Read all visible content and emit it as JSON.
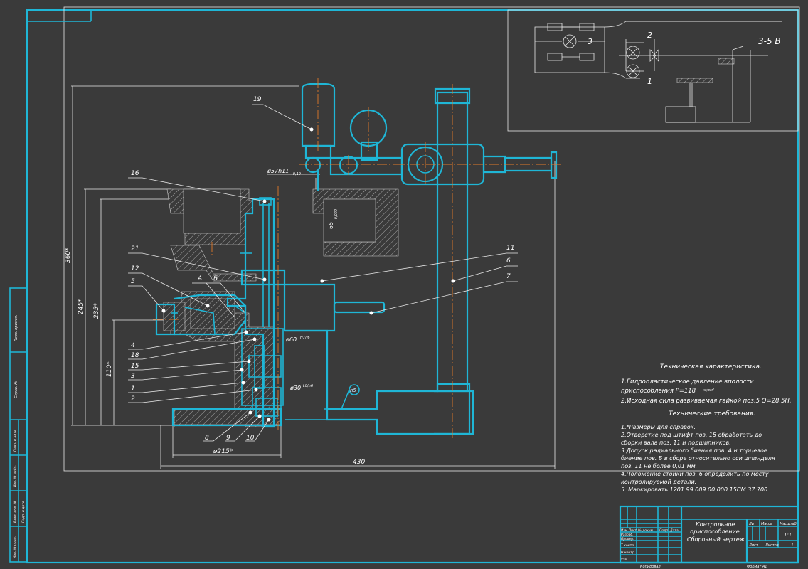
{
  "circuit": {
    "voltage_label": "3-5 В",
    "lamp_labels": [
      "3",
      "2",
      "1"
    ]
  },
  "callouts": [
    "19",
    "16",
    "21",
    "12",
    "5",
    "11",
    "6",
    "7",
    "А",
    "Б",
    "4",
    "18",
    "15",
    "3",
    "1",
    "2",
    "8",
    "9",
    "10"
  ],
  "dimensions": {
    "phi57": "ø57h11",
    "phi57_tol": "-0,19",
    "d65": "65",
    "d65_tol": "-0,022",
    "d360": "360*",
    "d245": "245*",
    "d235": "235*",
    "d110": "110*",
    "phi60": "ø60",
    "phi60_fit": "H7/f6",
    "phi30": "ø30",
    "phi30_fit": "L0/h6",
    "phi215": "ø215*",
    "d430": "430",
    "rough": "n5"
  },
  "tech_char": {
    "title": "Техническая характеристика.",
    "line1a": "1.Гидропластическое давление вполости",
    "line1b": "приспособления P=118",
    "unit": "кг/см²",
    "line2": "2.Исходная сила развиваемая гайкой поз.5 Q=28,5Н."
  },
  "tech_req": {
    "title": "Технические требования.",
    "lines": [
      "1.*Размеры для справок.",
      "2.Отверстие под штифт поз. 15 обработать до",
      "сборки вала поз. 11 и подшипников.",
      "3.Допуск радиального биения пов. А и торцевое",
      "биение пов. Б в сборе относительно оси шпинделя",
      "поз. 11 не более 0,01 мм.",
      "4.Положение стойки поз. 6 определить по месту",
      "контролируемой детали.",
      "5. Маркировать 1201.99.009.00.000.15ПМ.37.700."
    ]
  },
  "title_block": {
    "name1": "Контрольное",
    "name2": "приспособление",
    "name3": "Сборочный чертеж",
    "lit": "Лит",
    "mass": "Масса",
    "scale": "Масштаб",
    "scale_val": "1:1",
    "sheet": "Лист",
    "sheets": "Листов",
    "sheets_val": "1",
    "copied": "Копировал",
    "format": "Формат А1",
    "rows": [
      "Изм Лист",
      "№ докум.",
      "Подп.",
      "Дата",
      "Разраб.",
      "Провер.",
      "Т.контр.",
      "Н.контр.",
      "Утв."
    ]
  },
  "side_stamp": [
    "Перв. примен.",
    "Справ. №",
    "Подп. и дата",
    "Инв. № дубл.",
    "Взам. инв. №",
    "Подп. и дата",
    "Инв. № подл."
  ]
}
